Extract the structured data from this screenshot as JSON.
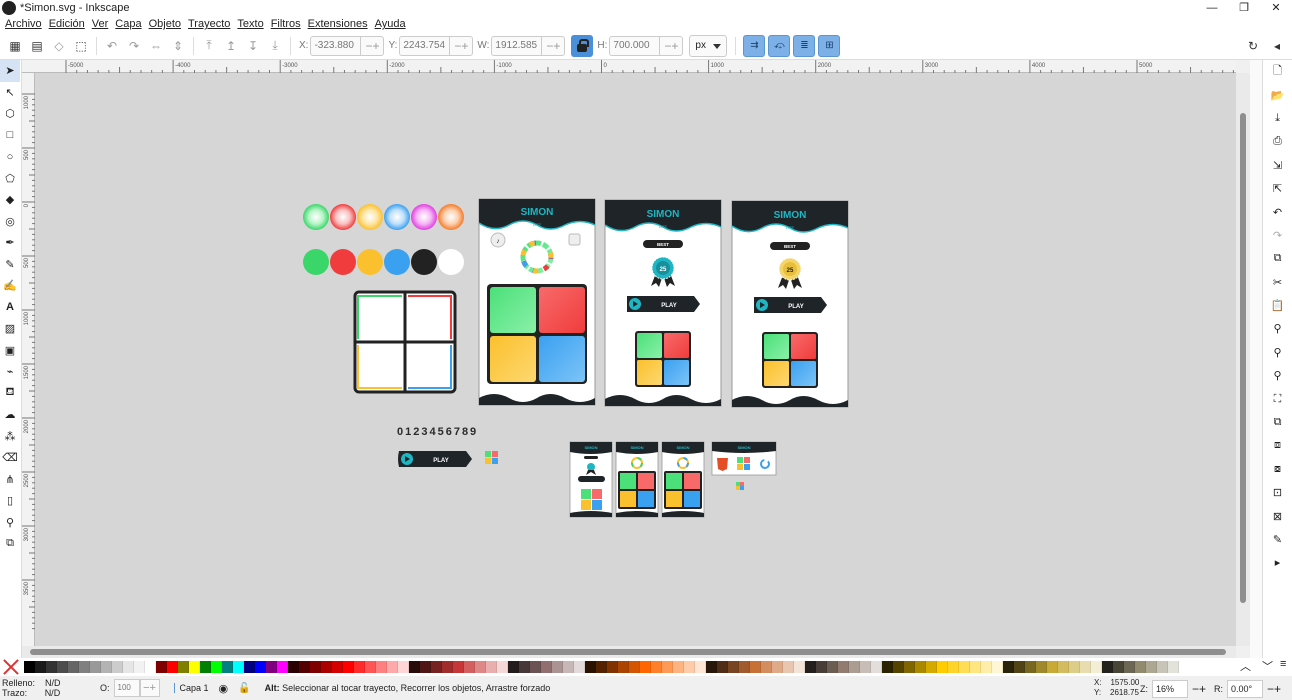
{
  "window": {
    "title": "*Simon.svg - Inkscape",
    "min": "—",
    "max": "❐",
    "close": "✕"
  },
  "menu": [
    "Archivo",
    "Edición",
    "Ver",
    "Capa",
    "Objeto",
    "Trayecto",
    "Texto",
    "Filtros",
    "Extensiones",
    "Ayuda"
  ],
  "toolbar": {
    "x_label": "X:",
    "x_value": "-323.880",
    "y_label": "Y:",
    "y_value": "2243.754",
    "w_label": "W:",
    "w_value": "1912.585",
    "h_label": "H:",
    "h_value": "700.000",
    "units": "px",
    "plusminus": "−+"
  },
  "ruler": {
    "h_ticks": [
      "-5000",
      "-4000",
      "-3000",
      "-2000",
      "-1000",
      "0",
      "1000",
      "2000",
      "3000",
      "4000",
      "5000"
    ],
    "v_ticks": [
      "1000",
      "500",
      "0",
      "500",
      "1000",
      "1500",
      "2000",
      "2500",
      "3000",
      "3500"
    ]
  },
  "artwork": {
    "simon": "SIMON",
    "lite": "LITE",
    "best": "BEST",
    "score": "25",
    "play": "PLAY",
    "digits": "0123456789"
  },
  "status": {
    "fill_label": "Relleno:",
    "fill_value": "N/D",
    "stroke_label": "Trazo:",
    "stroke_value": "N/D",
    "opacity_label": "O:",
    "opacity_value": "100",
    "layer": "Capa 1",
    "message_bold": "Alt:",
    "message": " Seleccionar al tocar trayecto, Recorrer los objetos, Arrastre forzado",
    "cx_label": "X:",
    "cx": "1575.00",
    "cy_label": "Y:",
    "cy": "2618.75",
    "zoom_label": "Z:",
    "zoom": "16%",
    "rot_label": "R:",
    "rot": "0.00°"
  },
  "colors": {
    "accent": "#4a90d9",
    "green": "#3ad66a",
    "red": "#f03c3c",
    "yellow": "#fbc02d",
    "blue": "#3aa0f0",
    "dark": "#1f2428",
    "teal": "#1fb6c4"
  }
}
